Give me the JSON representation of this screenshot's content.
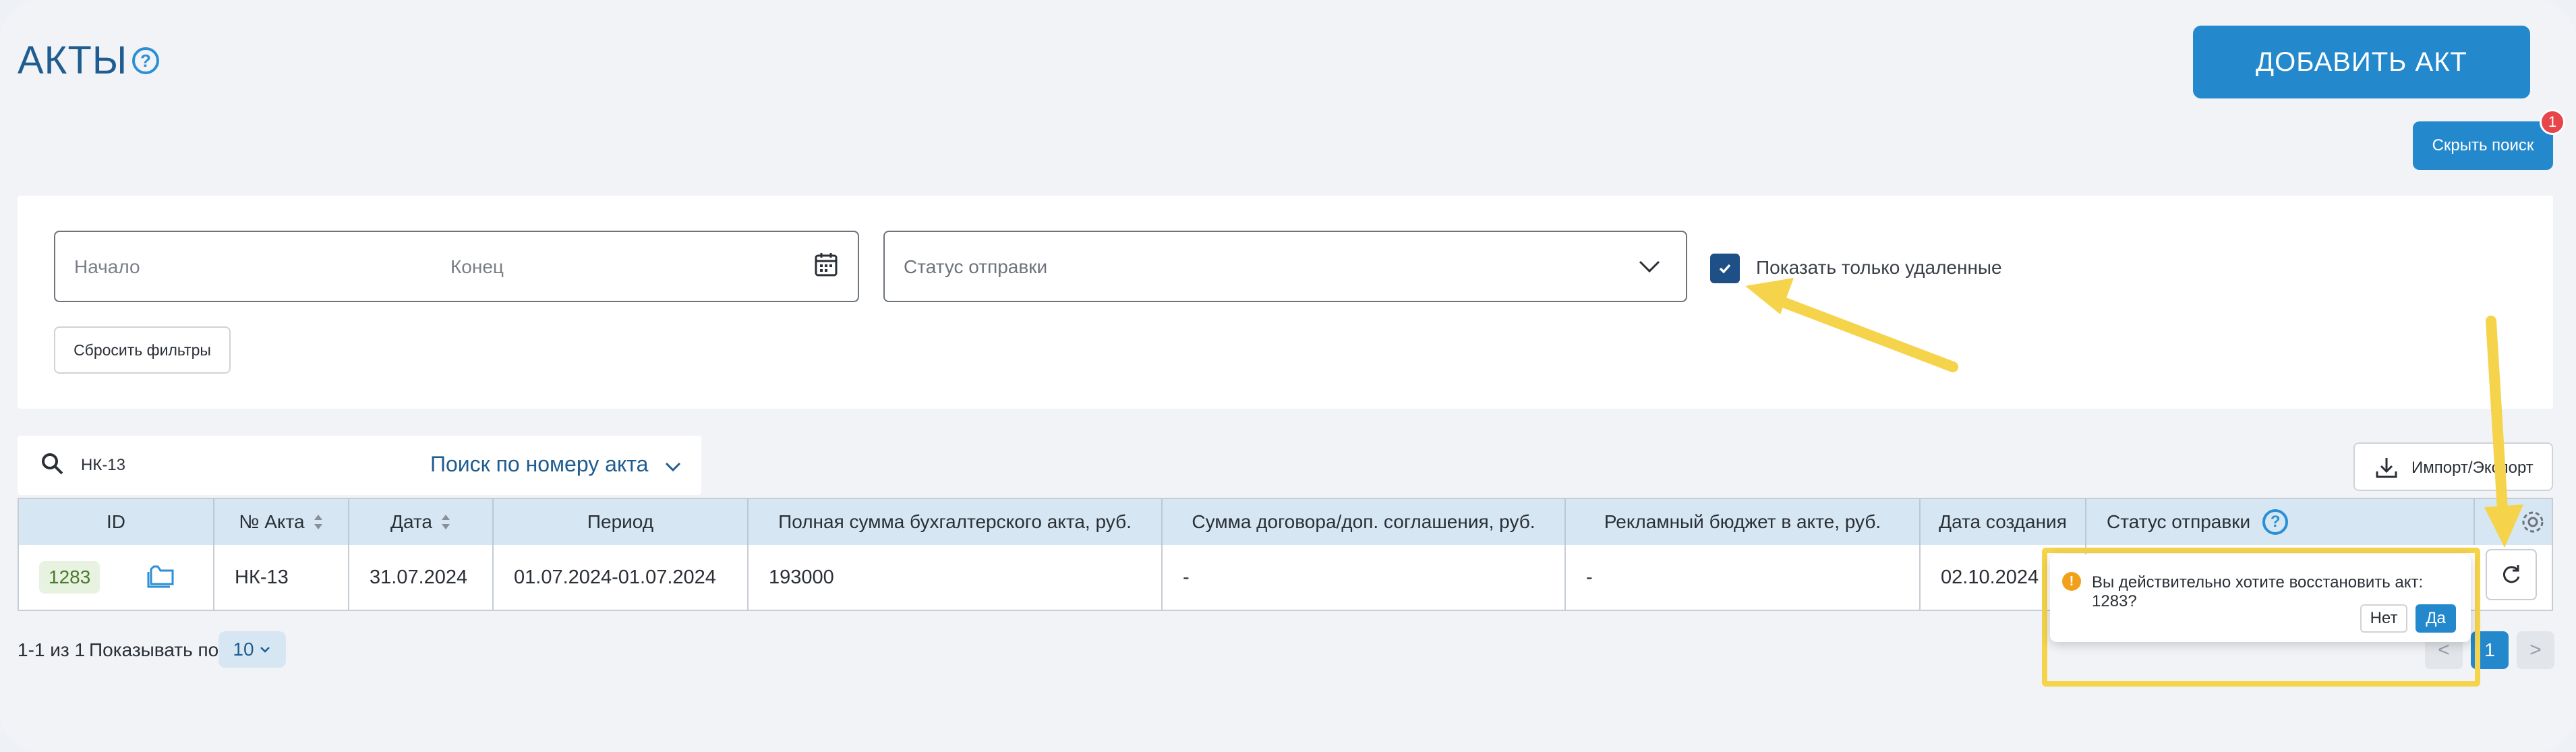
{
  "header": {
    "title": "АКТЫ",
    "add_button": "ДОБАВИТЬ АКТ",
    "hide_search_button": "Скрыть поиск",
    "notification_count": "1"
  },
  "filters": {
    "date_start_placeholder": "Начало",
    "date_end_placeholder": "Конец",
    "status_placeholder": "Статус отправки",
    "show_deleted_label": "Показать только удаленные",
    "show_deleted_checked": true,
    "reset_button": "Сбросить фильтры"
  },
  "search": {
    "value": "НК-13",
    "mode": "Поиск по номеру акта",
    "import_export": "Импорт/Экспорт"
  },
  "table": {
    "columns": [
      "ID",
      "№ Акта",
      "Дата",
      "Период",
      "Полная сумма бухгалтерского акта, руб.",
      "Сумма договора/доп. соглашения, руб.",
      "Рекламный бюджет в акте, руб.",
      "Дата создания",
      "Статус отправки"
    ],
    "rows": [
      {
        "id": "1283",
        "number": "НК-13",
        "date": "31.07.2024",
        "period": "01.07.2024-01.07.2024",
        "full_sum": "193000",
        "contract_sum": "-",
        "ad_budget": "-",
        "created": "02.10.2024"
      }
    ]
  },
  "pagination": {
    "range": "1-1 из 1",
    "per_page_label": "Показывать по",
    "per_page": "10",
    "current_page": "1",
    "prev": "<",
    "next": ">"
  },
  "popconfirm": {
    "message": "Вы действительно хотите восстановить акт: 1283?",
    "no": "Нет",
    "yes": "Да"
  },
  "colors": {
    "accent": "#2389cc",
    "title": "#1f5c8f",
    "header_bg": "#d6e7f3",
    "annotation": "#f5d34a"
  }
}
